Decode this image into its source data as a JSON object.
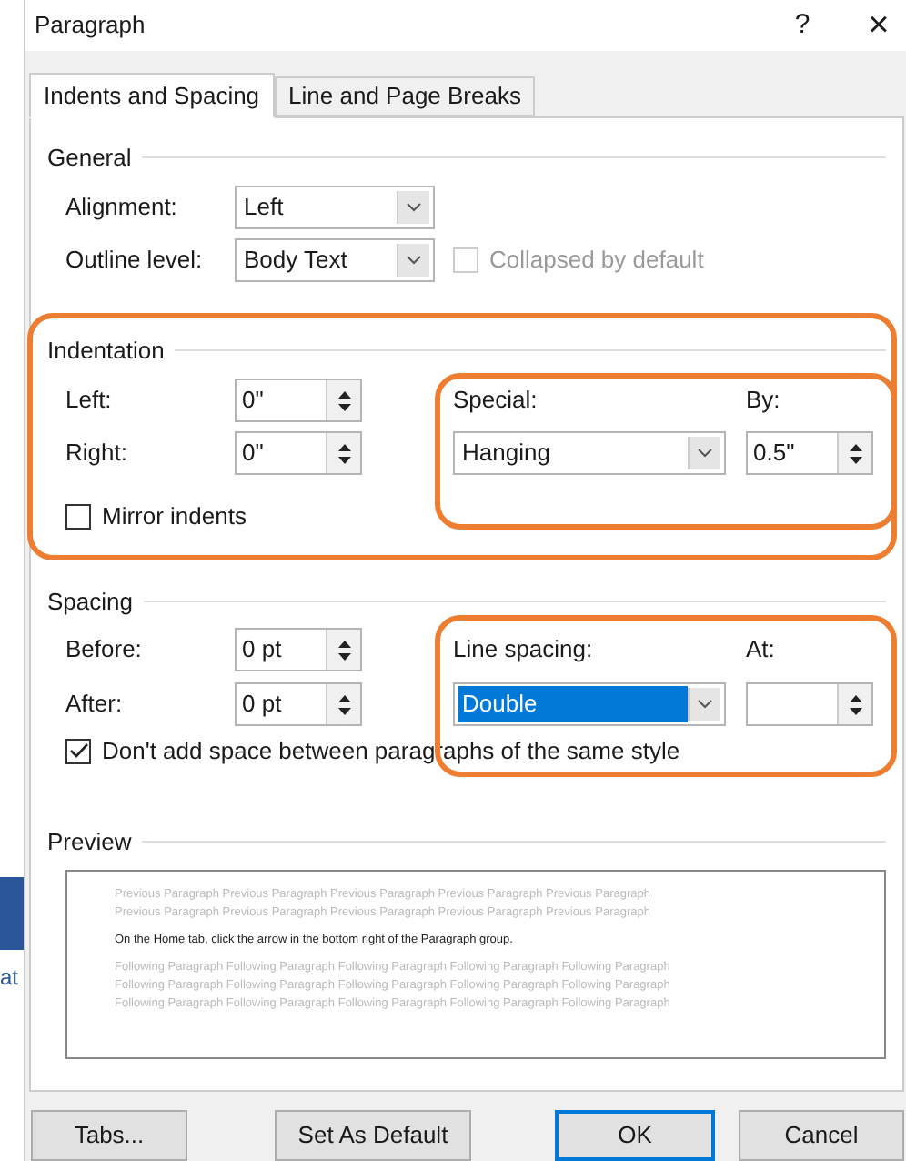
{
  "window": {
    "title": "Paragraph",
    "help": "?",
    "close": "×"
  },
  "tabs": [
    {
      "label": "Indents and Spacing",
      "selected": true
    },
    {
      "label": "Line and Page Breaks",
      "selected": false
    }
  ],
  "general": {
    "title": "General",
    "alignment": {
      "label": "Alignment:",
      "value": "Left"
    },
    "outline_level": {
      "label": "Outline level:",
      "value": "Body Text"
    },
    "collapsed": {
      "label": "Collapsed by default",
      "checked": false,
      "disabled": true
    }
  },
  "indentation": {
    "title": "Indentation",
    "left": {
      "label": "Left:",
      "value": "0\""
    },
    "right": {
      "label": "Right:",
      "value": "0\""
    },
    "special": {
      "label": "Special:",
      "value": "Hanging"
    },
    "by": {
      "label": "By:",
      "value": "0.5\""
    },
    "mirror": {
      "label": "Mirror indents",
      "checked": false
    }
  },
  "spacing": {
    "title": "Spacing",
    "before": {
      "label": "Before:",
      "value": "0 pt"
    },
    "after": {
      "label": "After:",
      "value": "0 pt"
    },
    "line_spacing": {
      "label": "Line spacing:",
      "value": "Double",
      "selected": true
    },
    "at": {
      "label": "At:"
    },
    "dont_add": {
      "label": "Don't add space between paragraphs of the same style",
      "checked": true
    }
  },
  "preview": {
    "title": "Preview",
    "previous_lines": [
      "Previous Paragraph Previous Paragraph Previous Paragraph Previous Paragraph Previous Paragraph",
      "Previous Paragraph Previous Paragraph Previous Paragraph Previous Paragraph Previous Paragraph"
    ],
    "sample": "On the Home tab, click the arrow in the bottom right of the Paragraph group.",
    "following_lines": [
      "Following Paragraph Following Paragraph Following Paragraph Following Paragraph Following Paragraph",
      "Following Paragraph Following Paragraph Following Paragraph Following Paragraph Following Paragraph",
      "Following Paragraph Following Paragraph Following Paragraph Following Paragraph Following Paragraph"
    ]
  },
  "buttons": [
    {
      "label": "Tabs...",
      "default": false
    },
    {
      "label": "Set As Default",
      "default": false
    },
    {
      "label": "OK",
      "default": true
    },
    {
      "label": "Cancel",
      "default": false
    }
  ],
  "background": {
    "fragment": "at"
  }
}
